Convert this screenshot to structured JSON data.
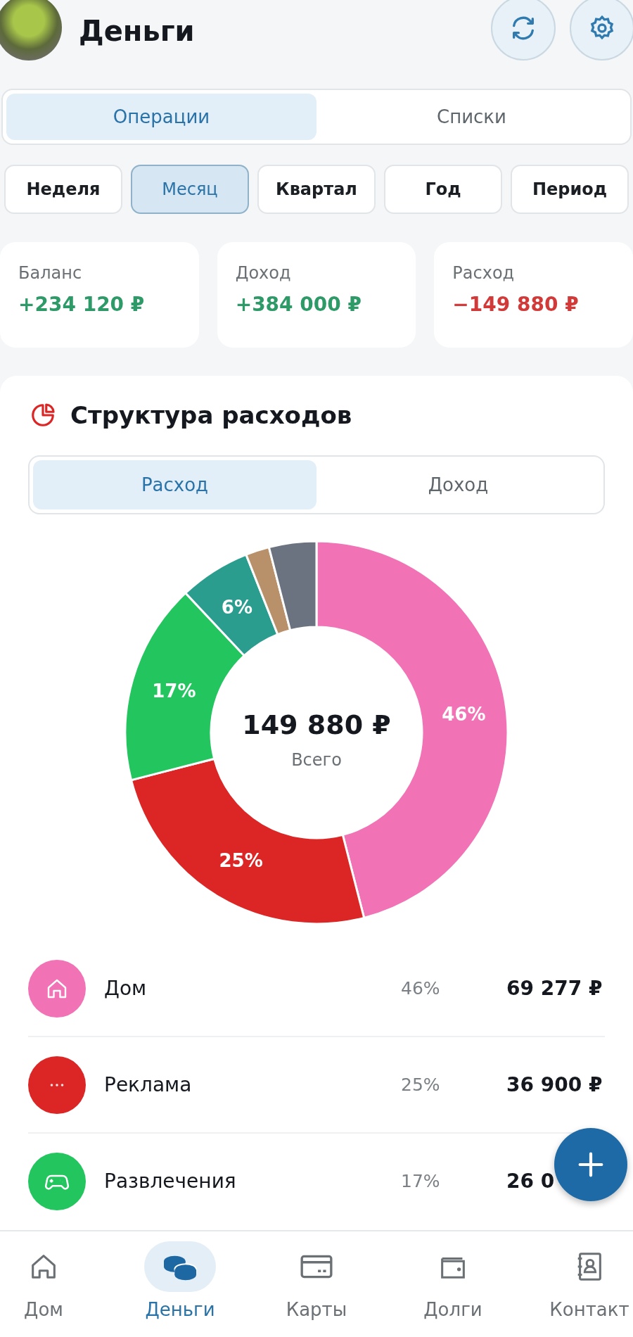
{
  "header": {
    "title": "Деньги"
  },
  "main_tabs": [
    {
      "label": "Операции",
      "selected": true
    },
    {
      "label": "Списки",
      "selected": false
    }
  ],
  "periods": [
    {
      "label": "Неделя",
      "selected": false
    },
    {
      "label": "Месяц",
      "selected": true
    },
    {
      "label": "Квартал",
      "selected": false
    },
    {
      "label": "Год",
      "selected": false
    },
    {
      "label": "Период",
      "selected": false
    }
  ],
  "summary": [
    {
      "label": "Баланс",
      "value": "+234 120 ₽",
      "color": "#2e9a68"
    },
    {
      "label": "Доход",
      "value": "+384 000 ₽",
      "color": "#2e9a68"
    },
    {
      "label": "Расход",
      "value": "−149 880 ₽",
      "color": "#d23a3a"
    }
  ],
  "expenses": {
    "title": "Структура расходов",
    "tabs": [
      {
        "label": "Расход",
        "selected": true
      },
      {
        "label": "Доход",
        "selected": false
      }
    ],
    "chart_data": {
      "type": "donut",
      "values": [
        46,
        25,
        17,
        6,
        2,
        4
      ],
      "colors": [
        "#f272b6",
        "#dc2626",
        "#22c55e",
        "#2a9d8f",
        "#b8916a",
        "#6b7280"
      ],
      "value_labels": [
        "46%",
        "25%",
        "17%",
        "6%",
        null,
        null
      ]
    },
    "total": "149 880 ₽",
    "total_label": "Всего",
    "categories": [
      {
        "name": "Дом",
        "percent": "46%",
        "amount": "69 277 ₽",
        "color": "#f272b6",
        "kind": "house"
      },
      {
        "name": "Реклама",
        "percent": "25%",
        "amount": "36 900 ₽",
        "color": "#dc2626",
        "kind": "dots"
      },
      {
        "name": "Развлечения",
        "percent": "17%",
        "amount": "26 0",
        "color": "#22c55e",
        "kind": "gamepad"
      }
    ]
  },
  "nav": [
    {
      "label": "Дом",
      "kind": "house",
      "selected": false
    },
    {
      "label": "Деньги",
      "kind": "coins",
      "selected": true
    },
    {
      "label": "Карты",
      "kind": "card",
      "selected": false
    },
    {
      "label": "Долги",
      "kind": "wallet",
      "selected": false
    },
    {
      "label": "Контакт",
      "kind": "contacts",
      "selected": false
    }
  ]
}
